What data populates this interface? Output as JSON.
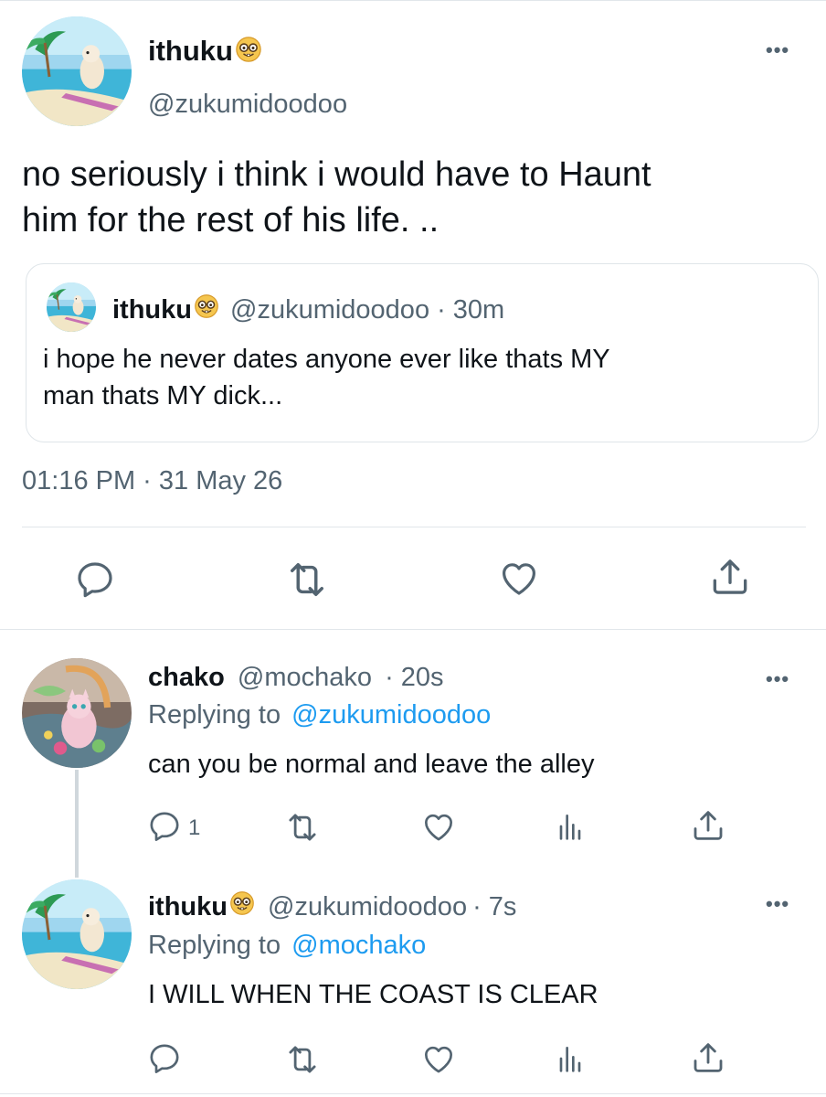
{
  "main_tweet": {
    "display_name": "ithuku",
    "handle": "@zukumidoodoo",
    "text_line1": "no seriously i think i would have to Haunt",
    "text_line2": "him for the rest of his life. ..",
    "timestamp": "01:16 PM · 31 May 26",
    "more_label": "•••"
  },
  "quoted_tweet": {
    "display_name": "ithuku",
    "handle": "@zukumidoodoo",
    "time": "· 30m",
    "text_line1": "i hope he never dates anyone ever like thats MY",
    "text_line2": "man thats MY dick..."
  },
  "replies": [
    {
      "display_name": "chako",
      "handle": "@mochako",
      "time": "· 20s",
      "replying_prefix": "Replying to",
      "replying_to": "@zukumidoodoo",
      "text": "can you be normal and leave the alley",
      "reply_count": "1",
      "more_label": "•••"
    },
    {
      "display_name": "ithuku",
      "handle": "@zukumidoodoo",
      "time": "· 7s",
      "replying_prefix": "Replying to",
      "replying_to": "@mochako",
      "text": "I WILL WHEN THE COAST IS CLEAR",
      "reply_count": "",
      "more_label": "•••"
    }
  ],
  "icons": {
    "reply": "reply-icon",
    "retweet": "retweet-icon",
    "like": "heart-icon",
    "share": "share-icon",
    "analytics": "analytics-icon",
    "nerd_emoji": "nerd-face-emoji-icon"
  },
  "colors": {
    "text": "#0f1419",
    "secondary": "#536471",
    "link": "#1d9bf0",
    "divider": "#e1e6ea"
  }
}
